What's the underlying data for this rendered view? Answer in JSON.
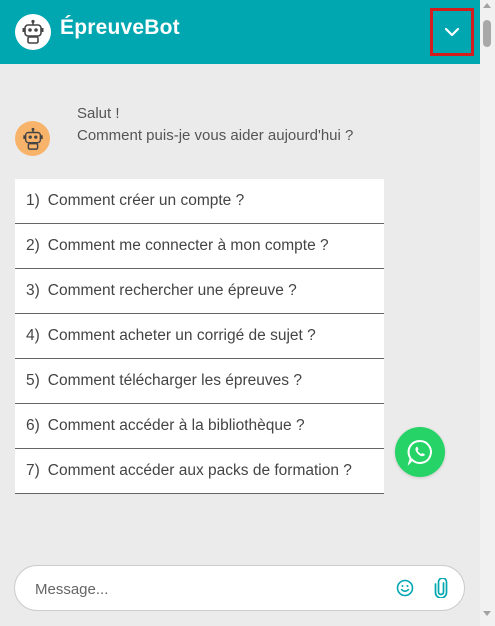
{
  "header": {
    "title": "ÉpreuveBot",
    "logo_icon": "robot-icon",
    "collapse_icon": "chevron-down-icon",
    "background": "#00a6b0",
    "highlight_border": "#d31c1c"
  },
  "bot": {
    "avatar_icon": "robot-icon",
    "avatar_color": "#f8b36b",
    "greeting_line1": "Salut !",
    "greeting_line2": "Comment puis-je vous aider aujourd'hui ?"
  },
  "faq": [
    {
      "num": "1)",
      "text": "Comment créer un compte ?"
    },
    {
      "num": "2)",
      "text": "Comment me connecter à mon compte ?"
    },
    {
      "num": "3)",
      "text": "Comment rechercher une épreuve ?"
    },
    {
      "num": "4)",
      "text": "Comment acheter un corrigé de sujet ?"
    },
    {
      "num": "5)",
      "text": "Comment télécharger les épreuves ?"
    },
    {
      "num": "6)",
      "text": "Comment accéder à la bibliothèque ?"
    },
    {
      "num": "7)",
      "text": "Comment accéder aux packs de formation ?"
    }
  ],
  "whatsapp": {
    "icon": "whatsapp-icon",
    "color": "#25d366"
  },
  "composer": {
    "placeholder": "Message...",
    "value": "",
    "emoji_icon": "smiley-icon",
    "attach_icon": "paperclip-icon",
    "icon_color": "#00a6b0"
  }
}
